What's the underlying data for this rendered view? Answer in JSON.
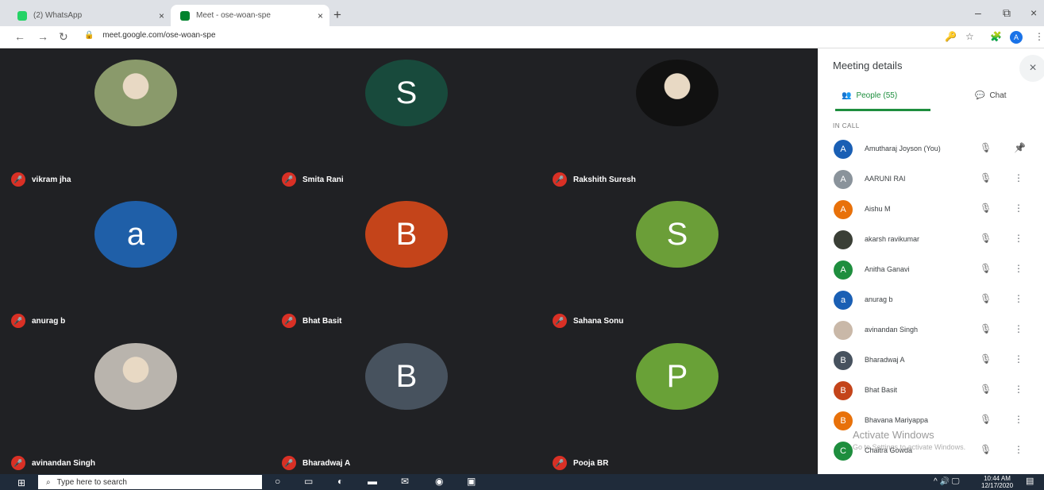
{
  "browser": {
    "tabs": [
      {
        "title": "(2) WhatsApp",
        "favicon_color": "#25d366"
      },
      {
        "title": "Meet - ose-woan-spe",
        "favicon_color": "#00832d"
      }
    ],
    "tab_close": "×",
    "new_tab": "+",
    "url": "meet.google.com/ose-woan-spe",
    "profile_initial": "A",
    "window_controls": {
      "minimize": "–",
      "restore": "⧉",
      "close": "×"
    }
  },
  "tiles": [
    {
      "name": "vikram jha",
      "initial": "",
      "color": "#8a9a6b",
      "photo": true
    },
    {
      "name": "Smita Rani",
      "initial": "S",
      "color": "#184a3c",
      "photo": false
    },
    {
      "name": "Rakshith Suresh",
      "initial": "",
      "color": "#111111",
      "photo": true
    },
    {
      "name": "anurag b",
      "initial": "a",
      "color": "#1f5fa8",
      "photo": false
    },
    {
      "name": "Bhat Basit",
      "initial": "B",
      "color": "#c4441a",
      "photo": false
    },
    {
      "name": "Sahana Sonu",
      "initial": "S",
      "color": "#6b9e38",
      "photo": false
    },
    {
      "name": "avinandan Singh",
      "initial": "",
      "color": "#b9b4ad",
      "photo": true
    },
    {
      "name": "Bharadwaj A",
      "initial": "B",
      "color": "#47525e",
      "photo": false
    },
    {
      "name": "Pooja BR",
      "initial": "P",
      "color": "#69a137",
      "photo": false
    }
  ],
  "panel": {
    "title": "Meeting details",
    "close": "×",
    "people_tab": "People (55)",
    "chat_tab": "Chat",
    "section_label": "IN CALL",
    "people": [
      {
        "name": "Amutharaj Joyson (You)",
        "initial": "A",
        "color": "#1a5fb4",
        "action": "pin"
      },
      {
        "name": "AARUNI RAI",
        "initial": "A",
        "color": "#8a939b",
        "action": "more"
      },
      {
        "name": "Aishu M",
        "initial": "A",
        "color": "#e8710a",
        "action": "more"
      },
      {
        "name": "akarsh ravikumar",
        "initial": "",
        "color": "#3a3f36",
        "action": "more"
      },
      {
        "name": "Anitha Ganavi",
        "initial": "A",
        "color": "#1e8e3e",
        "action": "more"
      },
      {
        "name": "anurag b",
        "initial": "a",
        "color": "#1a5fb4",
        "action": "more"
      },
      {
        "name": "avinandan Singh",
        "initial": "",
        "color": "#c9b8a8",
        "action": "more"
      },
      {
        "name": "Bharadwaj A",
        "initial": "B",
        "color": "#47525e",
        "action": "more"
      },
      {
        "name": "Bhat Basit",
        "initial": "B",
        "color": "#c4441a",
        "action": "more"
      },
      {
        "name": "Bhavana Mariyappa",
        "initial": "B",
        "color": "#e8710a",
        "action": "more"
      },
      {
        "name": "Chaitra Gowda",
        "initial": "C",
        "color": "#1e8e3e",
        "action": "more"
      }
    ],
    "watermark_title": "Activate Windows",
    "watermark_sub": "Go to Settings to activate Windows."
  },
  "taskbar": {
    "search_placeholder": "Type here to search",
    "time": "10:44 AM",
    "date": "12/17/2020"
  },
  "icons": {
    "mic_off": "🎤",
    "more": "⋮",
    "pin": "📌"
  }
}
